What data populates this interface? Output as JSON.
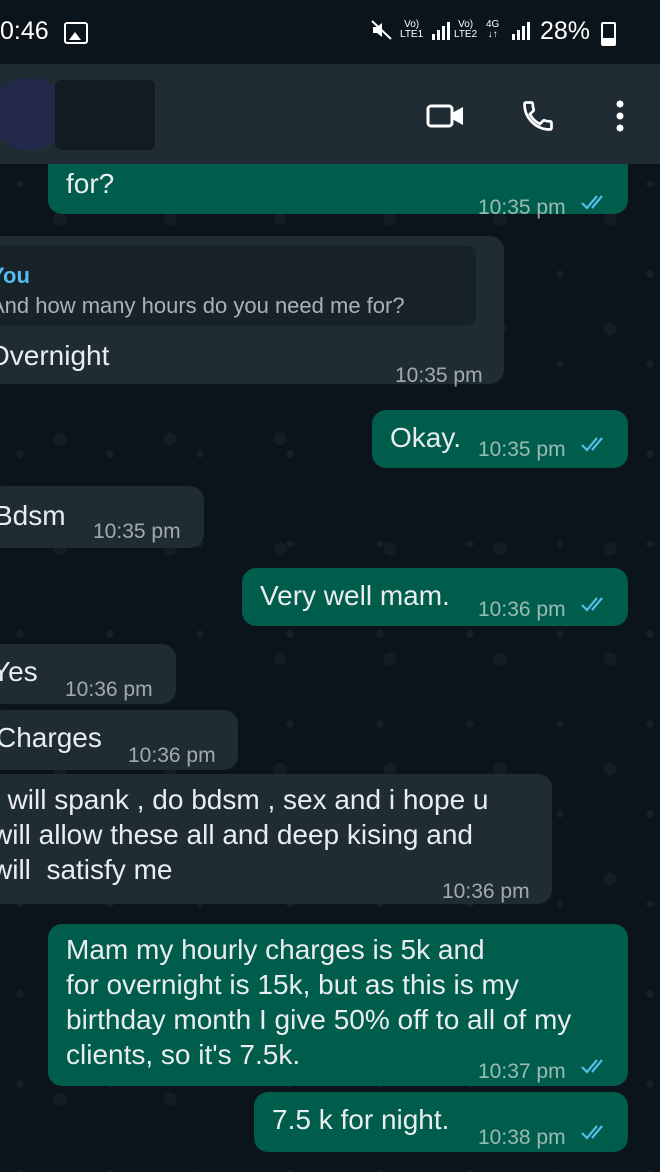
{
  "status_bar": {
    "time": "0:46",
    "net1_top": "Vo)",
    "net1_bottom": "LTE1",
    "net2_top": "Vo)",
    "net2_bottom": "LTE2",
    "net3_top": "4G",
    "net3_bottom": "↓↑",
    "battery": "28%"
  },
  "header": {
    "contact_name": "",
    "actions": [
      "video-call-icon",
      "voice-call-icon",
      "more-options-icon"
    ]
  },
  "messages": [
    {
      "dir": "out",
      "text": "for?",
      "time": "10:35 pm",
      "read": true
    },
    {
      "dir": "in",
      "quoted_author": "You",
      "quoted_text": "And how many hours do you need me for?",
      "text": "Overnight",
      "time": "10:35 pm"
    },
    {
      "dir": "out",
      "text": "Okay.",
      "time": "10:35 pm",
      "read": true
    },
    {
      "dir": "in",
      "text": "Bdsm",
      "time": "10:35 pm"
    },
    {
      "dir": "out",
      "text": "Very well mam.",
      "time": "10:36 pm",
      "read": true
    },
    {
      "dir": "in",
      "text": "Yes",
      "time": "10:36 pm"
    },
    {
      "dir": "in",
      "text": "Charges",
      "time": "10:36 pm"
    },
    {
      "dir": "in",
      "text": "I will spank , do bdsm , sex and i hope u\nwill allow these all and deep kising and\nwill  satisfy me",
      "time": "10:36 pm"
    },
    {
      "dir": "out",
      "text": "Mam my hourly charges is 5k and\nfor overnight is 15k, but as this is my\nbirthday month I give 50% off to all of my\nclients, so it's 7.5k.",
      "time": "10:37 pm",
      "read": true
    },
    {
      "dir": "out",
      "text": "7.5 k for night.",
      "time": "10:38 pm",
      "read": true
    }
  ],
  "colors": {
    "background": "#0b141a",
    "header": "#1f2c34",
    "outgoing_bubble": "#005c4b",
    "incoming_bubble": "#1f2c34",
    "read_ticks": "#53bdeb",
    "quote_author": "#53bdeb"
  }
}
